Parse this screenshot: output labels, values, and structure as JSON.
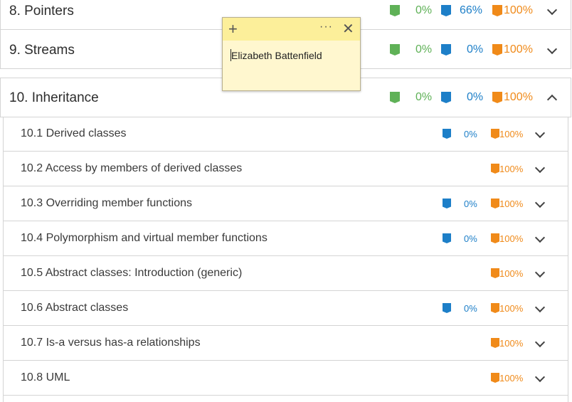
{
  "chapters": [
    {
      "title": "8. Pointers",
      "green": "0%",
      "blue": "66%",
      "orange": "100%"
    },
    {
      "title": "9. Streams",
      "green": "0%",
      "blue": "0%",
      "orange": "100%"
    },
    {
      "title": "10. Inheritance",
      "green": "0%",
      "blue": "0%",
      "orange": "100%"
    }
  ],
  "sections": [
    {
      "title": "10.1 Derived classes",
      "blue": "0%",
      "orange": "100%"
    },
    {
      "title": "10.2 Access by members of derived classes",
      "orange": "100%"
    },
    {
      "title": "10.3 Overriding member functions",
      "blue": "0%",
      "orange": "100%"
    },
    {
      "title": "10.4 Polymorphism and virtual member functions",
      "blue": "0%",
      "orange": "100%"
    },
    {
      "title": "10.5 Abstract classes: Introduction (generic)",
      "orange": "100%"
    },
    {
      "title": "10.6 Abstract classes",
      "blue": "0%",
      "orange": "100%"
    },
    {
      "title": "10.7 Is-a versus has-a relationships",
      "orange": "100%"
    },
    {
      "title": "10.8 UML",
      "orange": "100%"
    }
  ],
  "sticky_note": {
    "plus": "+",
    "menu": "···",
    "close": "✕",
    "text": "Elizabeth Battenfield"
  },
  "colors": {
    "green": "#5fb157",
    "blue": "#1d7fc8",
    "orange": "#f08a19"
  },
  "icons": {
    "activity": "bookmark-shape-icon",
    "expand": "chevron-down-icon",
    "collapse": "chevron-up-icon"
  }
}
